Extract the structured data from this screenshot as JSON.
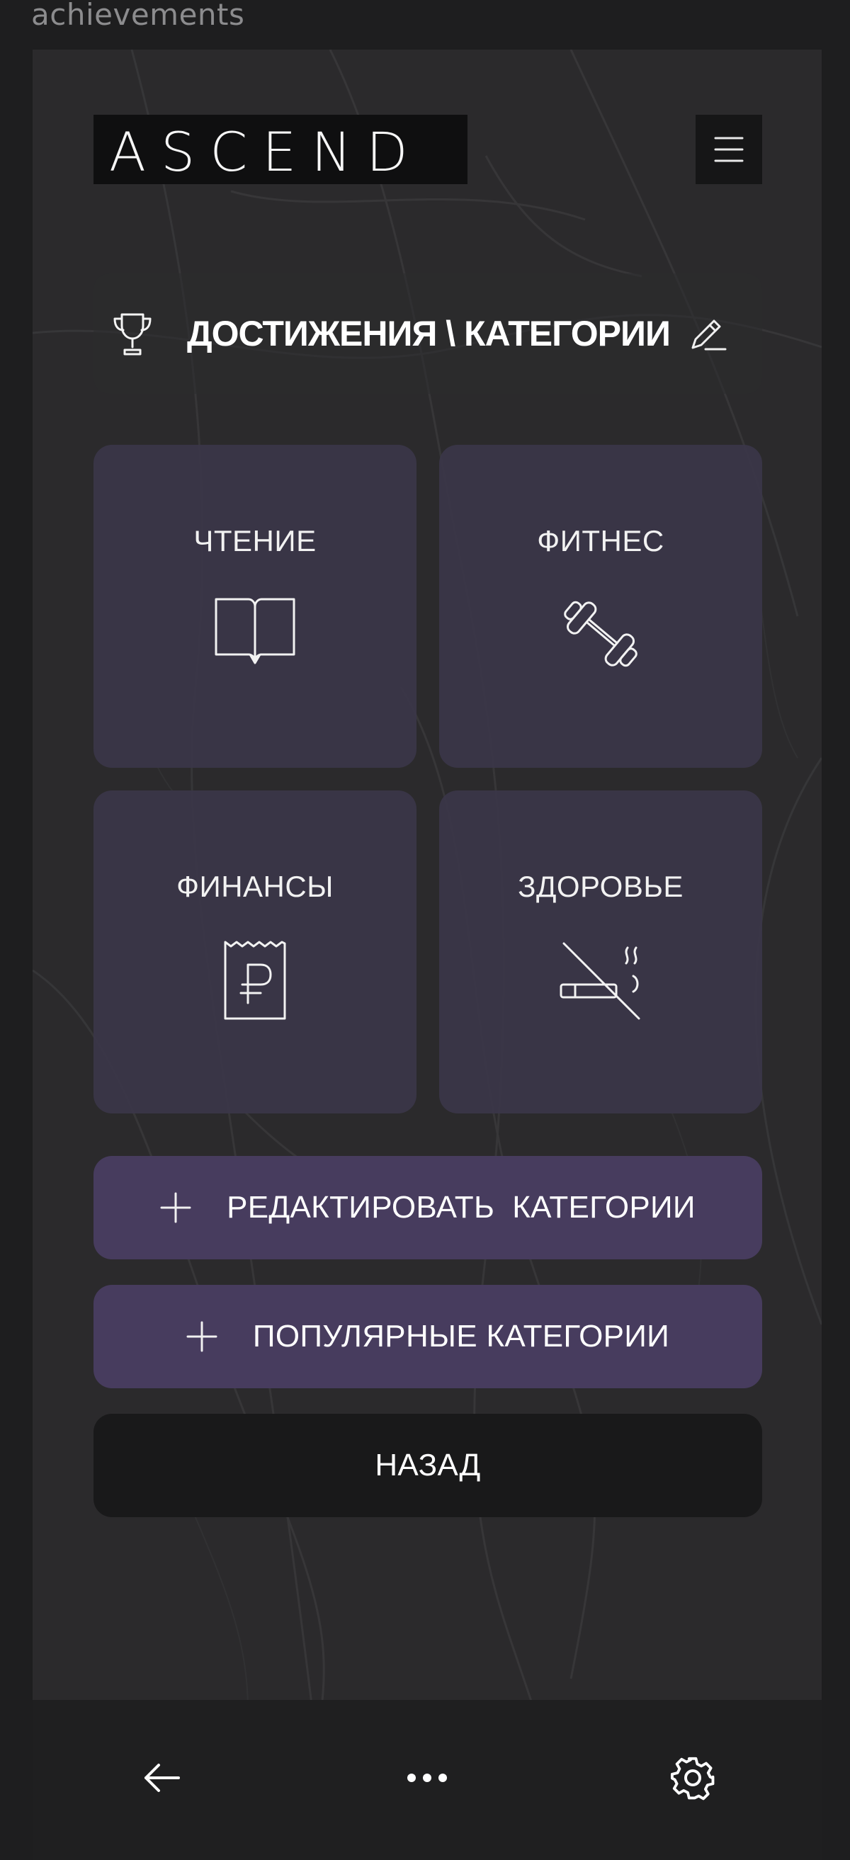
{
  "window": {
    "label": "achievements"
  },
  "header": {
    "logo": "ASCEND",
    "menu_icon": "hamburger-menu-icon"
  },
  "section": {
    "title": "ДОСТИЖЕНИЯ \\ КАТЕГОРИИ",
    "title_icon": "trophy-icon",
    "edit_icon": "pencil-icon"
  },
  "categories": [
    {
      "label": "ЧТЕНИЕ",
      "icon": "book-icon"
    },
    {
      "label": "ФИТНЕС",
      "icon": "dumbbell-icon"
    },
    {
      "label": "ФИНАНСЫ",
      "icon": "ruble-receipt-icon"
    },
    {
      "label": "ЗДОРОВЬЕ",
      "icon": "no-smoking-icon"
    }
  ],
  "actions": {
    "edit_categories": "РЕДАКТИРОВАТЬ  КАТЕГОРИИ",
    "popular_categories": "ПОПУЛЯРНЫЕ КАТЕГОРИИ",
    "back": "НАЗАД"
  },
  "bottom_nav": {
    "left_icon": "arrow-left-icon",
    "center_icon": "more-dots-icon",
    "right_icon": "gear-icon"
  },
  "colors": {
    "background": "#1e1e1f",
    "screen": "#2b2a2c",
    "tile": "#3a3648",
    "primary_button": "#473c5e",
    "dark_button": "#19191a",
    "text": "#ffffff"
  }
}
